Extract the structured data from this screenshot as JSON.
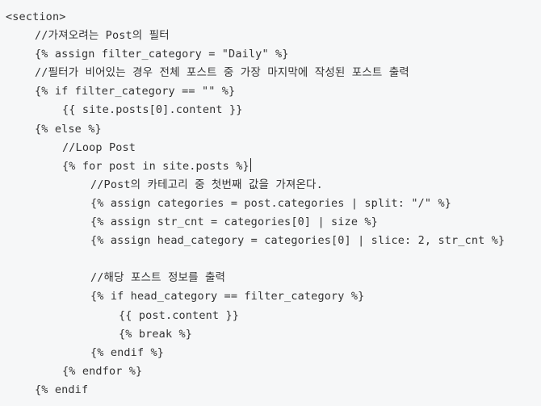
{
  "code": {
    "lines": [
      {
        "indent": 0,
        "text": "<section>"
      },
      {
        "indent": 1,
        "text": "//가져오려는 Post의 필터"
      },
      {
        "indent": 1,
        "text": "{% assign filter_category = \"Daily\" %}"
      },
      {
        "indent": 1,
        "text": "//필터가 비어있는 경우 전체 포스트 중 가장 마지막에 작성된 포스트 출력"
      },
      {
        "indent": 1,
        "text": "{% if filter_category == \"\" %}"
      },
      {
        "indent": 2,
        "text": "{{ site.posts[0].content }}"
      },
      {
        "indent": 1,
        "text": "{% else %}"
      },
      {
        "indent": 2,
        "text": "//Loop Post"
      },
      {
        "indent": 2,
        "text": "{% for post in site.posts %}"
      },
      {
        "indent": 3,
        "text": "//Post의 카테고리 중 첫번째 값을 가져온다."
      },
      {
        "indent": 3,
        "text": "{% assign categories = post.categories | split: \"/\" %}"
      },
      {
        "indent": 3,
        "text": "{% assign str_cnt = categories[0] | size %}"
      },
      {
        "indent": 3,
        "text": "{% assign head_category = categories[0] | slice: 2, str_cnt %}"
      },
      {
        "indent": 0,
        "text": ""
      },
      {
        "indent": 3,
        "text": "//해당 포스트 정보를 출력"
      },
      {
        "indent": 3,
        "text": "{% if head_category == filter_category %}"
      },
      {
        "indent": 4,
        "text": "{{ post.content }}"
      },
      {
        "indent": 4,
        "text": "{% break %}"
      },
      {
        "indent": 3,
        "text": "{% endif %}"
      },
      {
        "indent": 2,
        "text": "{% endfor %}"
      },
      {
        "indent": 1,
        "text": "{% endif"
      }
    ]
  }
}
